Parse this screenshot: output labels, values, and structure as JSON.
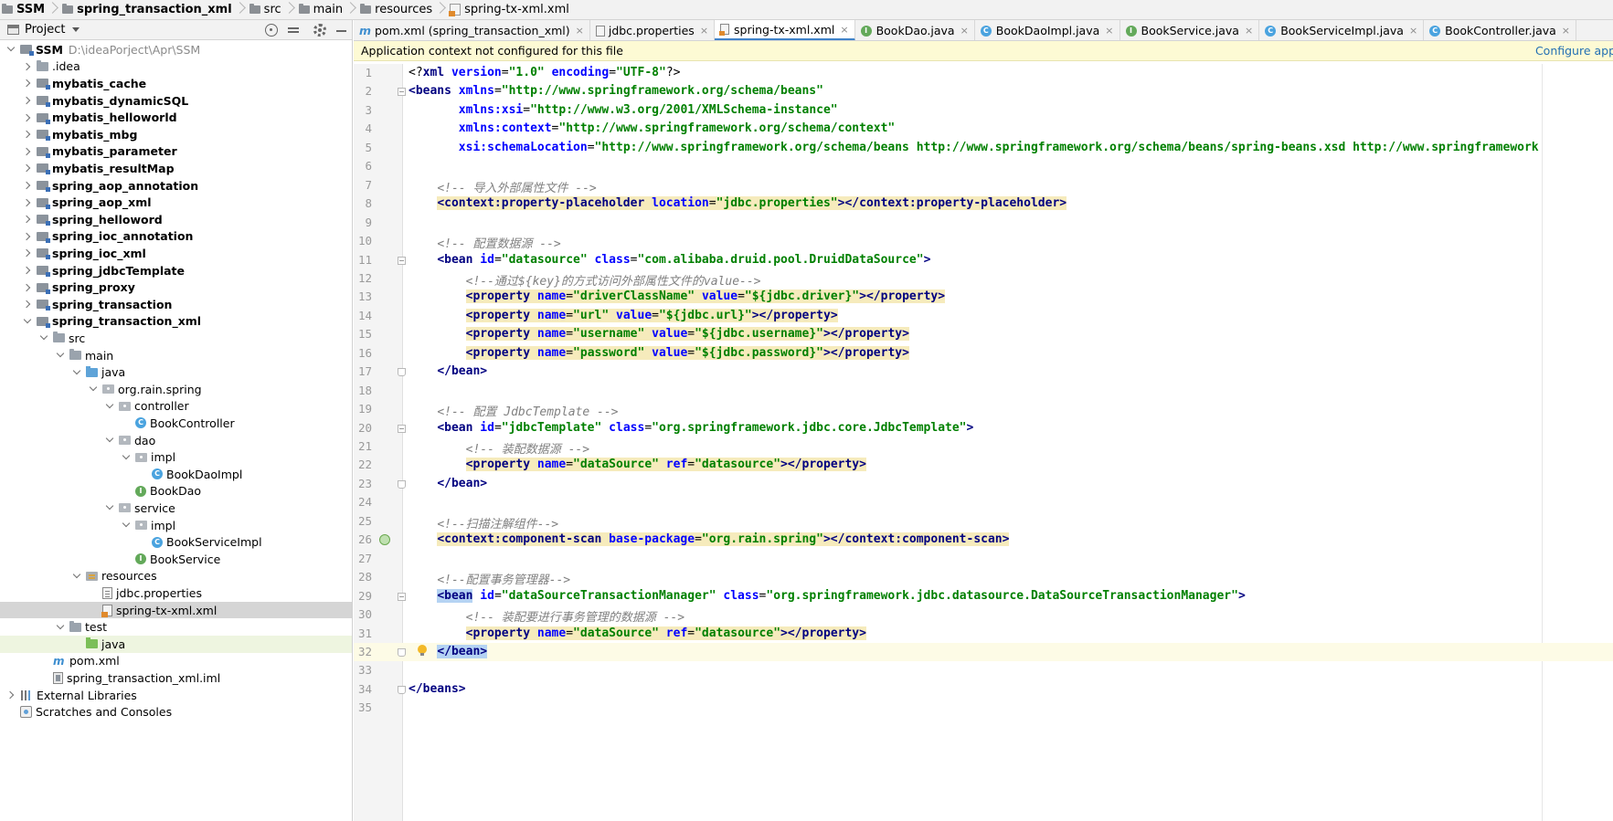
{
  "breadcrumb": [
    {
      "label": "SSM",
      "bold": true,
      "icon": "folder"
    },
    {
      "label": "spring_transaction_xml",
      "bold": true,
      "icon": "module"
    },
    {
      "label": "src",
      "bold": false,
      "icon": "folder"
    },
    {
      "label": "main",
      "bold": false,
      "icon": "folder"
    },
    {
      "label": "resources",
      "bold": false,
      "icon": "folder"
    },
    {
      "label": "spring-tx-xml.xml",
      "bold": false,
      "icon": "xml"
    }
  ],
  "project_panel": {
    "title": "Project",
    "tree": [
      {
        "depth": 0,
        "arrow": "down",
        "icon": "module",
        "label": "SSM",
        "bold": true,
        "path": "D:\\ideaPorject\\Apr\\SSM"
      },
      {
        "depth": 1,
        "arrow": "right",
        "icon": "folder",
        "label": ".idea",
        "bold": false
      },
      {
        "depth": 1,
        "arrow": "right",
        "icon": "module",
        "label": "mybatis_cache",
        "bold": true
      },
      {
        "depth": 1,
        "arrow": "right",
        "icon": "module",
        "label": "mybatis_dynamicSQL",
        "bold": true
      },
      {
        "depth": 1,
        "arrow": "right",
        "icon": "module",
        "label": "mybatis_helloworld",
        "bold": true
      },
      {
        "depth": 1,
        "arrow": "right",
        "icon": "module",
        "label": "mybatis_mbg",
        "bold": true
      },
      {
        "depth": 1,
        "arrow": "right",
        "icon": "module",
        "label": "mybatis_parameter",
        "bold": true
      },
      {
        "depth": 1,
        "arrow": "right",
        "icon": "module",
        "label": "mybatis_resultMap",
        "bold": true
      },
      {
        "depth": 1,
        "arrow": "right",
        "icon": "module",
        "label": "spring_aop_annotation",
        "bold": true
      },
      {
        "depth": 1,
        "arrow": "right",
        "icon": "module",
        "label": "spring_aop_xml",
        "bold": true
      },
      {
        "depth": 1,
        "arrow": "right",
        "icon": "module",
        "label": "spring_helloword",
        "bold": true
      },
      {
        "depth": 1,
        "arrow": "right",
        "icon": "module",
        "label": "spring_ioc_annotation",
        "bold": true
      },
      {
        "depth": 1,
        "arrow": "right",
        "icon": "module",
        "label": "spring_ioc_xml",
        "bold": true
      },
      {
        "depth": 1,
        "arrow": "right",
        "icon": "module",
        "label": "spring_jdbcTemplate",
        "bold": true
      },
      {
        "depth": 1,
        "arrow": "right",
        "icon": "module",
        "label": "spring_proxy",
        "bold": true
      },
      {
        "depth": 1,
        "arrow": "right",
        "icon": "module",
        "label": "spring_transaction",
        "bold": true
      },
      {
        "depth": 1,
        "arrow": "down",
        "icon": "module",
        "label": "spring_transaction_xml",
        "bold": true
      },
      {
        "depth": 2,
        "arrow": "down",
        "icon": "folder",
        "label": "src",
        "bold": false
      },
      {
        "depth": 3,
        "arrow": "down",
        "icon": "folder",
        "label": "main",
        "bold": false
      },
      {
        "depth": 4,
        "arrow": "down",
        "icon": "src-folder",
        "label": "java",
        "bold": false
      },
      {
        "depth": 5,
        "arrow": "down",
        "icon": "pkg",
        "label": "org.rain.spring",
        "bold": false
      },
      {
        "depth": 6,
        "arrow": "down",
        "icon": "pkg",
        "label": "controller",
        "bold": false
      },
      {
        "depth": 7,
        "arrow": "none",
        "icon": "cls",
        "label": "BookController",
        "bold": false
      },
      {
        "depth": 6,
        "arrow": "down",
        "icon": "pkg",
        "label": "dao",
        "bold": false
      },
      {
        "depth": 7,
        "arrow": "down",
        "icon": "pkg",
        "label": "impl",
        "bold": false
      },
      {
        "depth": 8,
        "arrow": "none",
        "icon": "cls",
        "label": "BookDaoImpl",
        "bold": false
      },
      {
        "depth": 7,
        "arrow": "none",
        "icon": "intf",
        "label": "BookDao",
        "bold": false
      },
      {
        "depth": 6,
        "arrow": "down",
        "icon": "pkg",
        "label": "service",
        "bold": false
      },
      {
        "depth": 7,
        "arrow": "down",
        "icon": "pkg",
        "label": "impl",
        "bold": false
      },
      {
        "depth": 8,
        "arrow": "none",
        "icon": "cls",
        "label": "BookServiceImpl",
        "bold": false
      },
      {
        "depth": 7,
        "arrow": "none",
        "icon": "intf",
        "label": "BookService",
        "bold": false
      },
      {
        "depth": 4,
        "arrow": "down",
        "icon": "res-folder",
        "label": "resources",
        "bold": false
      },
      {
        "depth": 5,
        "arrow": "none",
        "icon": "props",
        "label": "jdbc.properties",
        "bold": false
      },
      {
        "depth": 5,
        "arrow": "none",
        "icon": "xmlf",
        "label": "spring-tx-xml.xml",
        "bold": false,
        "selected": true
      },
      {
        "depth": 3,
        "arrow": "down",
        "icon": "folder",
        "label": "test",
        "bold": false
      },
      {
        "depth": 4,
        "arrow": "none",
        "icon": "test-folder",
        "label": "java",
        "bold": false,
        "highlight": true
      },
      {
        "depth": 2,
        "arrow": "none",
        "icon": "pom",
        "label": "pom.xml",
        "bold": false
      },
      {
        "depth": 2,
        "arrow": "none",
        "icon": "iml",
        "label": "spring_transaction_xml.iml",
        "bold": false
      },
      {
        "depth": 0,
        "arrow": "right",
        "icon": "libs",
        "label": "External Libraries",
        "bold": false
      },
      {
        "depth": 0,
        "arrow": "none",
        "icon": "scratch",
        "label": "Scratches and Consoles",
        "bold": false
      }
    ]
  },
  "tabs": [
    {
      "label": "pom.xml (spring_transaction_xml)",
      "icon": "m",
      "active": false
    },
    {
      "label": "jdbc.properties",
      "icon": "p",
      "active": false
    },
    {
      "label": "spring-tx-xml.xml",
      "icon": "x",
      "active": true
    },
    {
      "label": "BookDao.java",
      "icon": "i",
      "active": false
    },
    {
      "label": "BookDaoImpl.java",
      "icon": "c",
      "active": false
    },
    {
      "label": "BookService.java",
      "icon": "i",
      "active": false
    },
    {
      "label": "BookServiceImpl.java",
      "icon": "c",
      "active": false
    },
    {
      "label": "BookController.java",
      "icon": "c",
      "active": false
    }
  ],
  "tab_close_glyph": "×",
  "notice": {
    "message": "Application context not configured for this file",
    "action": "Configure appli"
  },
  "code_lines": [
    {
      "n": "1",
      "parts": [
        [
          "pi",
          "<?"
        ],
        [
          "tag",
          "xml "
        ],
        [
          "attr",
          "version"
        ],
        [
          "pi",
          "="
        ],
        [
          "val",
          "\"1.0\" "
        ],
        [
          "attr",
          "encoding"
        ],
        [
          "pi",
          "="
        ],
        [
          "val",
          "\"UTF-8\""
        ],
        [
          "pi",
          "?>"
        ]
      ]
    },
    {
      "n": "2",
      "fold": "open",
      "parts": [
        [
          "tag",
          "<beans "
        ],
        [
          "attr",
          "xmlns"
        ],
        [
          "pi",
          "="
        ],
        [
          "val",
          "\"http://www.springframework.org/schema/beans\""
        ]
      ]
    },
    {
      "n": "3",
      "parts": [
        [
          "pi",
          "       "
        ],
        [
          "attr",
          "xmlns:xsi"
        ],
        [
          "pi",
          "="
        ],
        [
          "val",
          "\"http://www.w3.org/2001/XMLSchema-instance\""
        ]
      ]
    },
    {
      "n": "4",
      "parts": [
        [
          "pi",
          "       "
        ],
        [
          "attr",
          "xmlns:context"
        ],
        [
          "pi",
          "="
        ],
        [
          "val",
          "\"http://www.springframework.org/schema/context\""
        ]
      ]
    },
    {
      "n": "5",
      "parts": [
        [
          "pi",
          "       "
        ],
        [
          "attr",
          "xsi:schemaLocation"
        ],
        [
          "pi",
          "="
        ],
        [
          "val",
          "\"http://www.springframework.org/schema/beans http://www.springframework.org/schema/beans/spring-beans.xsd http://www.springframework"
        ]
      ]
    },
    {
      "n": "6",
      "parts": []
    },
    {
      "n": "7",
      "parts": [
        [
          "pi",
          "    "
        ],
        [
          "cmt",
          "<!-- 导入外部属性文件 -->"
        ]
      ]
    },
    {
      "n": "8",
      "parts": [
        [
          "pi",
          "    "
        ],
        [
          "hl-tag",
          "<context:property-placeholder "
        ],
        [
          "hl-attr",
          "location"
        ],
        [
          "hl-pi",
          "="
        ],
        [
          "hl-val",
          "\"jdbc.properties\""
        ],
        [
          "hl-tag",
          "></context:property-placeholder>"
        ]
      ]
    },
    {
      "n": "9",
      "parts": []
    },
    {
      "n": "10",
      "parts": [
        [
          "pi",
          "    "
        ],
        [
          "cmt",
          "<!-- 配置数据源 -->"
        ]
      ]
    },
    {
      "n": "11",
      "fold": "open",
      "parts": [
        [
          "pi",
          "    "
        ],
        [
          "tag",
          "<bean "
        ],
        [
          "attr",
          "id"
        ],
        [
          "pi",
          "="
        ],
        [
          "val",
          "\"datasource\" "
        ],
        [
          "attr",
          "class"
        ],
        [
          "pi",
          "="
        ],
        [
          "val",
          "\"com.alibaba.druid.pool.DruidDataSource\""
        ],
        [
          "tag",
          ">"
        ]
      ]
    },
    {
      "n": "12",
      "parts": [
        [
          "pi",
          "        "
        ],
        [
          "cmt",
          "<!--通过${key}的方式访问外部属性文件的value-->"
        ]
      ]
    },
    {
      "n": "13",
      "parts": [
        [
          "pi",
          "        "
        ],
        [
          "hl-tag",
          "<property "
        ],
        [
          "hl-attr",
          "name"
        ],
        [
          "hl-pi",
          "="
        ],
        [
          "hl-val",
          "\"driverClassName\" "
        ],
        [
          "hl-attr",
          "value"
        ],
        [
          "hl-pi",
          "="
        ],
        [
          "hl-val",
          "\"${jdbc.driver}\""
        ],
        [
          "hl-tag",
          "></property>"
        ]
      ]
    },
    {
      "n": "14",
      "parts": [
        [
          "pi",
          "        "
        ],
        [
          "hl-tag",
          "<property "
        ],
        [
          "hl-attr",
          "name"
        ],
        [
          "hl-pi",
          "="
        ],
        [
          "hl-val",
          "\"url\" "
        ],
        [
          "hl-attr",
          "value"
        ],
        [
          "hl-pi",
          "="
        ],
        [
          "hl-val",
          "\"${jdbc.url}\""
        ],
        [
          "hl-tag",
          "></property>"
        ]
      ]
    },
    {
      "n": "15",
      "parts": [
        [
          "pi",
          "        "
        ],
        [
          "hl-tag",
          "<property "
        ],
        [
          "hl-attr",
          "name"
        ],
        [
          "hl-pi",
          "="
        ],
        [
          "hl-val",
          "\"username\" "
        ],
        [
          "hl-attr",
          "value"
        ],
        [
          "hl-pi",
          "="
        ],
        [
          "hl-val",
          "\"${jdbc.username}\""
        ],
        [
          "hl-tag",
          "></property>"
        ]
      ]
    },
    {
      "n": "16",
      "parts": [
        [
          "pi",
          "        "
        ],
        [
          "hl-tag",
          "<property "
        ],
        [
          "hl-attr",
          "name"
        ],
        [
          "hl-pi",
          "="
        ],
        [
          "hl-val",
          "\"password\" "
        ],
        [
          "hl-attr",
          "value"
        ],
        [
          "hl-pi",
          "="
        ],
        [
          "hl-val",
          "\"${jdbc.password}\""
        ],
        [
          "hl-tag",
          "></property>"
        ]
      ]
    },
    {
      "n": "17",
      "fold": "end",
      "parts": [
        [
          "pi",
          "    "
        ],
        [
          "tag",
          "</bean>"
        ]
      ]
    },
    {
      "n": "18",
      "parts": []
    },
    {
      "n": "19",
      "parts": [
        [
          "pi",
          "    "
        ],
        [
          "cmt",
          "<!-- 配置 JdbcTemplate -->"
        ]
      ]
    },
    {
      "n": "20",
      "fold": "open",
      "parts": [
        [
          "pi",
          "    "
        ],
        [
          "tag",
          "<bean "
        ],
        [
          "attr",
          "id"
        ],
        [
          "pi",
          "="
        ],
        [
          "val",
          "\"jdbcTemplate\" "
        ],
        [
          "attr",
          "class"
        ],
        [
          "pi",
          "="
        ],
        [
          "val",
          "\"org.springframework.jdbc.core.JdbcTemplate\""
        ],
        [
          "tag",
          ">"
        ]
      ]
    },
    {
      "n": "21",
      "parts": [
        [
          "pi",
          "        "
        ],
        [
          "cmt",
          "<!-- 装配数据源 -->"
        ]
      ]
    },
    {
      "n": "22",
      "parts": [
        [
          "pi",
          "        "
        ],
        [
          "hl-tag",
          "<property "
        ],
        [
          "hl-attr",
          "name"
        ],
        [
          "hl-pi",
          "="
        ],
        [
          "hl-val",
          "\"dataSource\" "
        ],
        [
          "hl-attr",
          "ref"
        ],
        [
          "hl-pi",
          "="
        ],
        [
          "hl-val",
          "\"datasource\""
        ],
        [
          "hl-tag",
          "></property>"
        ]
      ]
    },
    {
      "n": "23",
      "fold": "end",
      "parts": [
        [
          "pi",
          "    "
        ],
        [
          "tag",
          "</bean>"
        ]
      ]
    },
    {
      "n": "24",
      "parts": []
    },
    {
      "n": "25",
      "parts": [
        [
          "pi",
          "    "
        ],
        [
          "cmt",
          "<!--扫描注解组件-->"
        ]
      ]
    },
    {
      "n": "26",
      "run": true,
      "parts": [
        [
          "pi",
          "    "
        ],
        [
          "hl-tag",
          "<context:component-scan "
        ],
        [
          "hl-attr",
          "base-package"
        ],
        [
          "hl-pi",
          "="
        ],
        [
          "hl-val",
          "\"org.rain.spring\""
        ],
        [
          "hl-tag",
          "></context:component-scan>"
        ]
      ]
    },
    {
      "n": "27",
      "parts": []
    },
    {
      "n": "28",
      "parts": [
        [
          "pi",
          "    "
        ],
        [
          "cmt",
          "<!--配置事务管理器-->"
        ]
      ]
    },
    {
      "n": "29",
      "fold": "open",
      "parts": [
        [
          "pi",
          "    "
        ],
        [
          "sel-tag",
          "<bean"
        ],
        [
          "tag",
          " "
        ],
        [
          "attr",
          "id"
        ],
        [
          "pi",
          "="
        ],
        [
          "val",
          "\"dataSourceTransactionManager\" "
        ],
        [
          "attr",
          "class"
        ],
        [
          "pi",
          "="
        ],
        [
          "val",
          "\"org.springframework.jdbc.datasource.DataSourceTransactionManager\""
        ],
        [
          "tag",
          ">"
        ]
      ]
    },
    {
      "n": "30",
      "parts": [
        [
          "pi",
          "        "
        ],
        [
          "cmt",
          "<!-- 装配要进行事务管理的数据源 -->"
        ]
      ]
    },
    {
      "n": "31",
      "parts": [
        [
          "pi",
          "        "
        ],
        [
          "hl-tag",
          "<property "
        ],
        [
          "hl-attr",
          "name"
        ],
        [
          "hl-pi",
          "="
        ],
        [
          "hl-val",
          "\"dataSource\" "
        ],
        [
          "hl-attr",
          "ref"
        ],
        [
          "hl-pi",
          "="
        ],
        [
          "hl-val",
          "\"datasource\""
        ],
        [
          "hl-tag",
          "></property>"
        ]
      ]
    },
    {
      "n": "32",
      "fold": "end",
      "current": true,
      "bulb": true,
      "parts": [
        [
          "pi",
          "    "
        ],
        [
          "sel-tag",
          "</bean>"
        ]
      ]
    },
    {
      "n": "33",
      "parts": []
    },
    {
      "n": "34",
      "fold": "end",
      "parts": [
        [
          "tag",
          "</beans>"
        ]
      ]
    },
    {
      "n": "35",
      "parts": []
    }
  ]
}
